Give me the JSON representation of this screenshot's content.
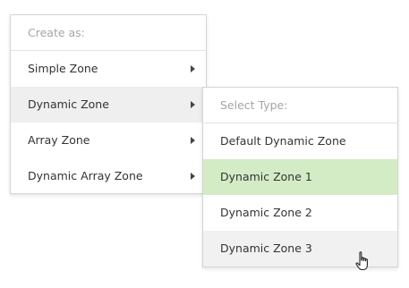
{
  "main_menu": {
    "header": "Create as:",
    "items": [
      {
        "label": "Simple Zone"
      },
      {
        "label": "Dynamic Zone"
      },
      {
        "label": "Array Zone"
      },
      {
        "label": "Dynamic Array Zone"
      }
    ]
  },
  "submenu": {
    "header": "Select Type:",
    "items": [
      {
        "label": "Default Dynamic Zone"
      },
      {
        "label": "Dynamic Zone 1"
      },
      {
        "label": "Dynamic Zone 2"
      },
      {
        "label": "Dynamic Zone 3"
      }
    ]
  },
  "icons": {
    "submenu_arrow": "chevron-right-icon",
    "cursor": "hand-pointer-icon"
  },
  "colors": {
    "selected_bg": "#d4ecc6",
    "hover_bg": "#efefef",
    "header_text": "#a5a5a5",
    "text": "#333333"
  }
}
